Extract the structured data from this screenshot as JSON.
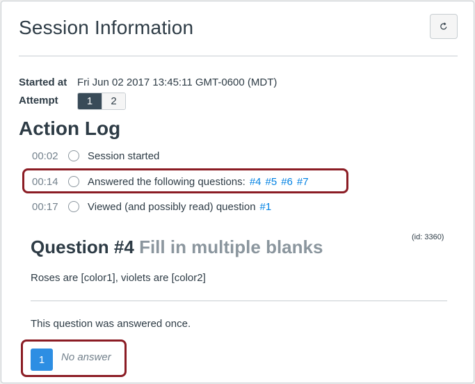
{
  "header": {
    "title": "Session Information",
    "refresh_icon": "refresh-icon"
  },
  "session": {
    "started_label": "Started at",
    "started_value": "Fri Jun 02 2017 13:45:11 GMT-0600 (MDT)",
    "attempt_label": "Attempt",
    "attempts": [
      "1",
      "2"
    ],
    "active_attempt": "1"
  },
  "action_log": {
    "title": "Action Log",
    "entries": [
      {
        "time": "00:02",
        "text": "Session started",
        "links": []
      },
      {
        "time": "00:14",
        "text": "Answered the following questions:",
        "links": [
          "#4",
          "#5",
          "#6",
          "#7"
        ]
      },
      {
        "time": "00:17",
        "text": "Viewed (and possibly read) question",
        "links": [
          "#1"
        ]
      }
    ]
  },
  "question": {
    "title": "Question #4",
    "type": "Fill in multiple blanks",
    "id_label": "(id: 3360)",
    "body": "Roses are [color1], violets are [color2]",
    "answered_text": "This question was answered once.",
    "answer_number": "1",
    "answer_text": "No answer"
  },
  "colors": {
    "accent": "#0081e3",
    "highlight": "#8b1c24",
    "active_attempt_bg": "#394b58",
    "answer_badge_bg": "#2d8ee3"
  }
}
